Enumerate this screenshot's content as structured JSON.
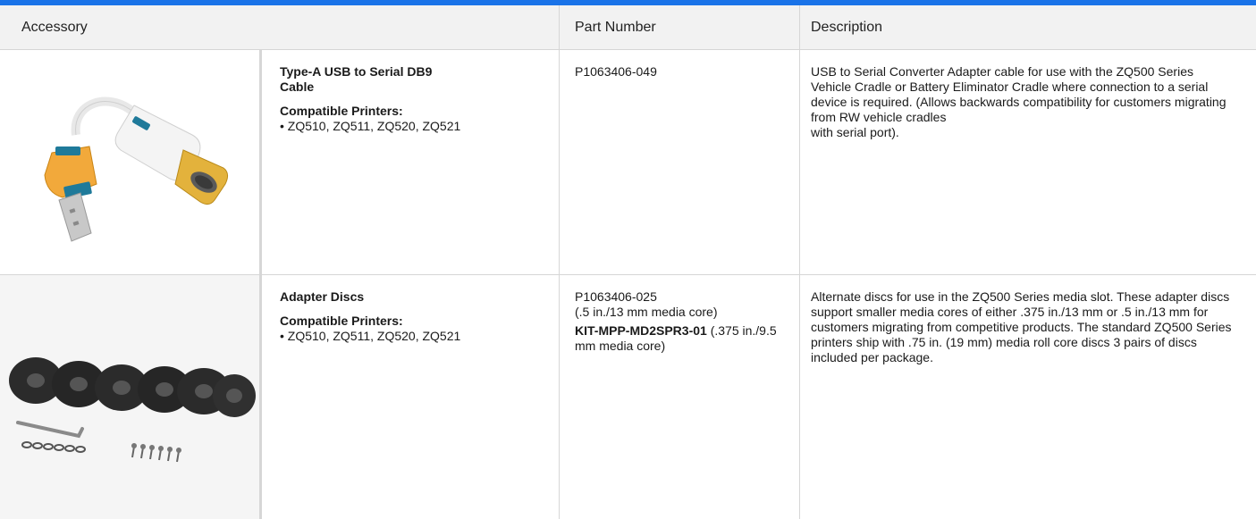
{
  "header": {
    "accessory": "Accessory",
    "part_number": "Part Number",
    "description": "Description"
  },
  "rows": [
    {
      "title": "Type-A USB to Serial DB9 Cable",
      "compat_label": "Compatible Printers:",
      "compat_list": "• ZQ510, ZQ511, ZQ520, ZQ521",
      "part_main": "P1063406-049",
      "description": "USB to Serial Converter Adapter cable for use with the ZQ500 Series Vehicle Cradle or Battery Eliminator Cradle where connection to a serial device is required. (Allows backwards compatibility for customers migrating from RW vehicle cradles\nwith serial port)."
    },
    {
      "title": "Adapter Discs",
      "compat_label": "Compatible Printers:",
      "compat_list": "• ZQ510, ZQ511, ZQ520, ZQ521",
      "part_main": "P1063406-025",
      "part_note": "(.5 in./13 mm media core)",
      "part2_bold": "KIT-MPP-MD2SPR3-01",
      "part2_rest": " (.375 in./9.5 mm media core)",
      "description": "Alternate discs for use in the ZQ500 Series media slot. These adapter discs support smaller media cores of either .375 in./13 mm or .5 in./13 mm for customers migrating from competitive products. The standard ZQ500 Series printers ship with .75 in. (19 mm) media roll core discs 3 pairs of discs included per package."
    }
  ],
  "colors": {
    "accent": "#1a73e8",
    "header_bg": "#f2f2f2",
    "border": "#d6d6d6"
  }
}
